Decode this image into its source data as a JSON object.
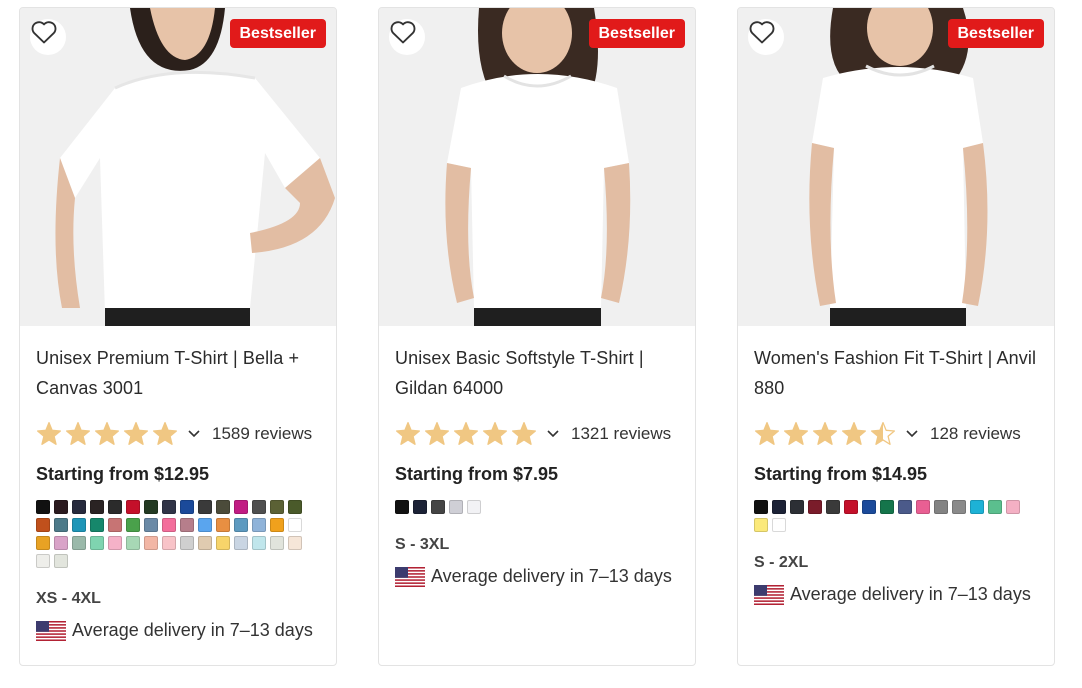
{
  "cards": [
    {
      "badge": "Bestseller",
      "title": "Unisex Premium T-Shirt | Bella + Canvas 3001",
      "rating": 5,
      "reviews": "1589 reviews",
      "price": "Starting from $12.95",
      "swatches": [
        "#111111",
        "#2b1a1f",
        "#262a3d",
        "#2a2323",
        "#2b2b2b",
        "#c4102a",
        "#233a22",
        "#303447",
        "#1b4a9a",
        "#3a3a3a",
        "#4b4b3a",
        "#c11c83",
        "#4f4f4f",
        "#5b6135",
        "#4a5a2a",
        "#c0501c",
        "#4d7a89",
        "#1f96b8",
        "#16876b",
        "#c77474",
        "#4aa14b",
        "#6a8aa6",
        "#f36e9b",
        "#b67e8b",
        "#5aa5ee",
        "#e88f42",
        "#5d9ac0",
        "#8fb3d9",
        "#f0a11c",
        "#ffffff",
        "#e8a224",
        "#d9a3c8",
        "#9ab9aa",
        "#7fd4b0",
        "#f5b2c8",
        "#a7d8b5",
        "#f2b6a5",
        "#f8c3c8",
        "#cfcfcf",
        "#e0cbb0",
        "#f7d46a",
        "#c9d5e3",
        "#c0e6ec",
        "#e1e4dc",
        "#f6e6d8",
        "#eeeeea",
        "#e2e5dd"
      ],
      "sizes": "XS - 4XL",
      "delivery": "Average delivery in 7–13 days"
    },
    {
      "badge": "Bestseller",
      "title": "Unisex Basic Softstyle T-Shirt | Gildan 64000",
      "rating": 5,
      "reviews": "1321 reviews",
      "price": "Starting from $7.95",
      "swatches": [
        "#111111",
        "#1c2236",
        "#444444",
        "#cfcfd6",
        "#f2f2f5"
      ],
      "sizes": "S - 3XL",
      "delivery": "Average delivery in 7–13 days"
    },
    {
      "badge": "Bestseller",
      "title": "Women's Fashion Fit T-Shirt | Anvil 880",
      "rating": 4.5,
      "reviews": "128 reviews",
      "price": "Starting from $14.95",
      "swatches": [
        "#111111",
        "#1c2236",
        "#2c2f35",
        "#7a1c2a",
        "#3a3a3a",
        "#c4102a",
        "#1b4a9a",
        "#15754b",
        "#4b5a8a",
        "#e95f93",
        "#838383",
        "#8a8a8a",
        "#1db2d6",
        "#5bbf8e",
        "#f4b0c4",
        "#fbe97a",
        "#ffffff"
      ],
      "sizes": "S - 2XL",
      "delivery": "Average delivery in 7–13 days"
    }
  ],
  "colors": {
    "badge": "#e11a1a",
    "star": "#f0c783",
    "star_empty": "#e6e6e6"
  }
}
